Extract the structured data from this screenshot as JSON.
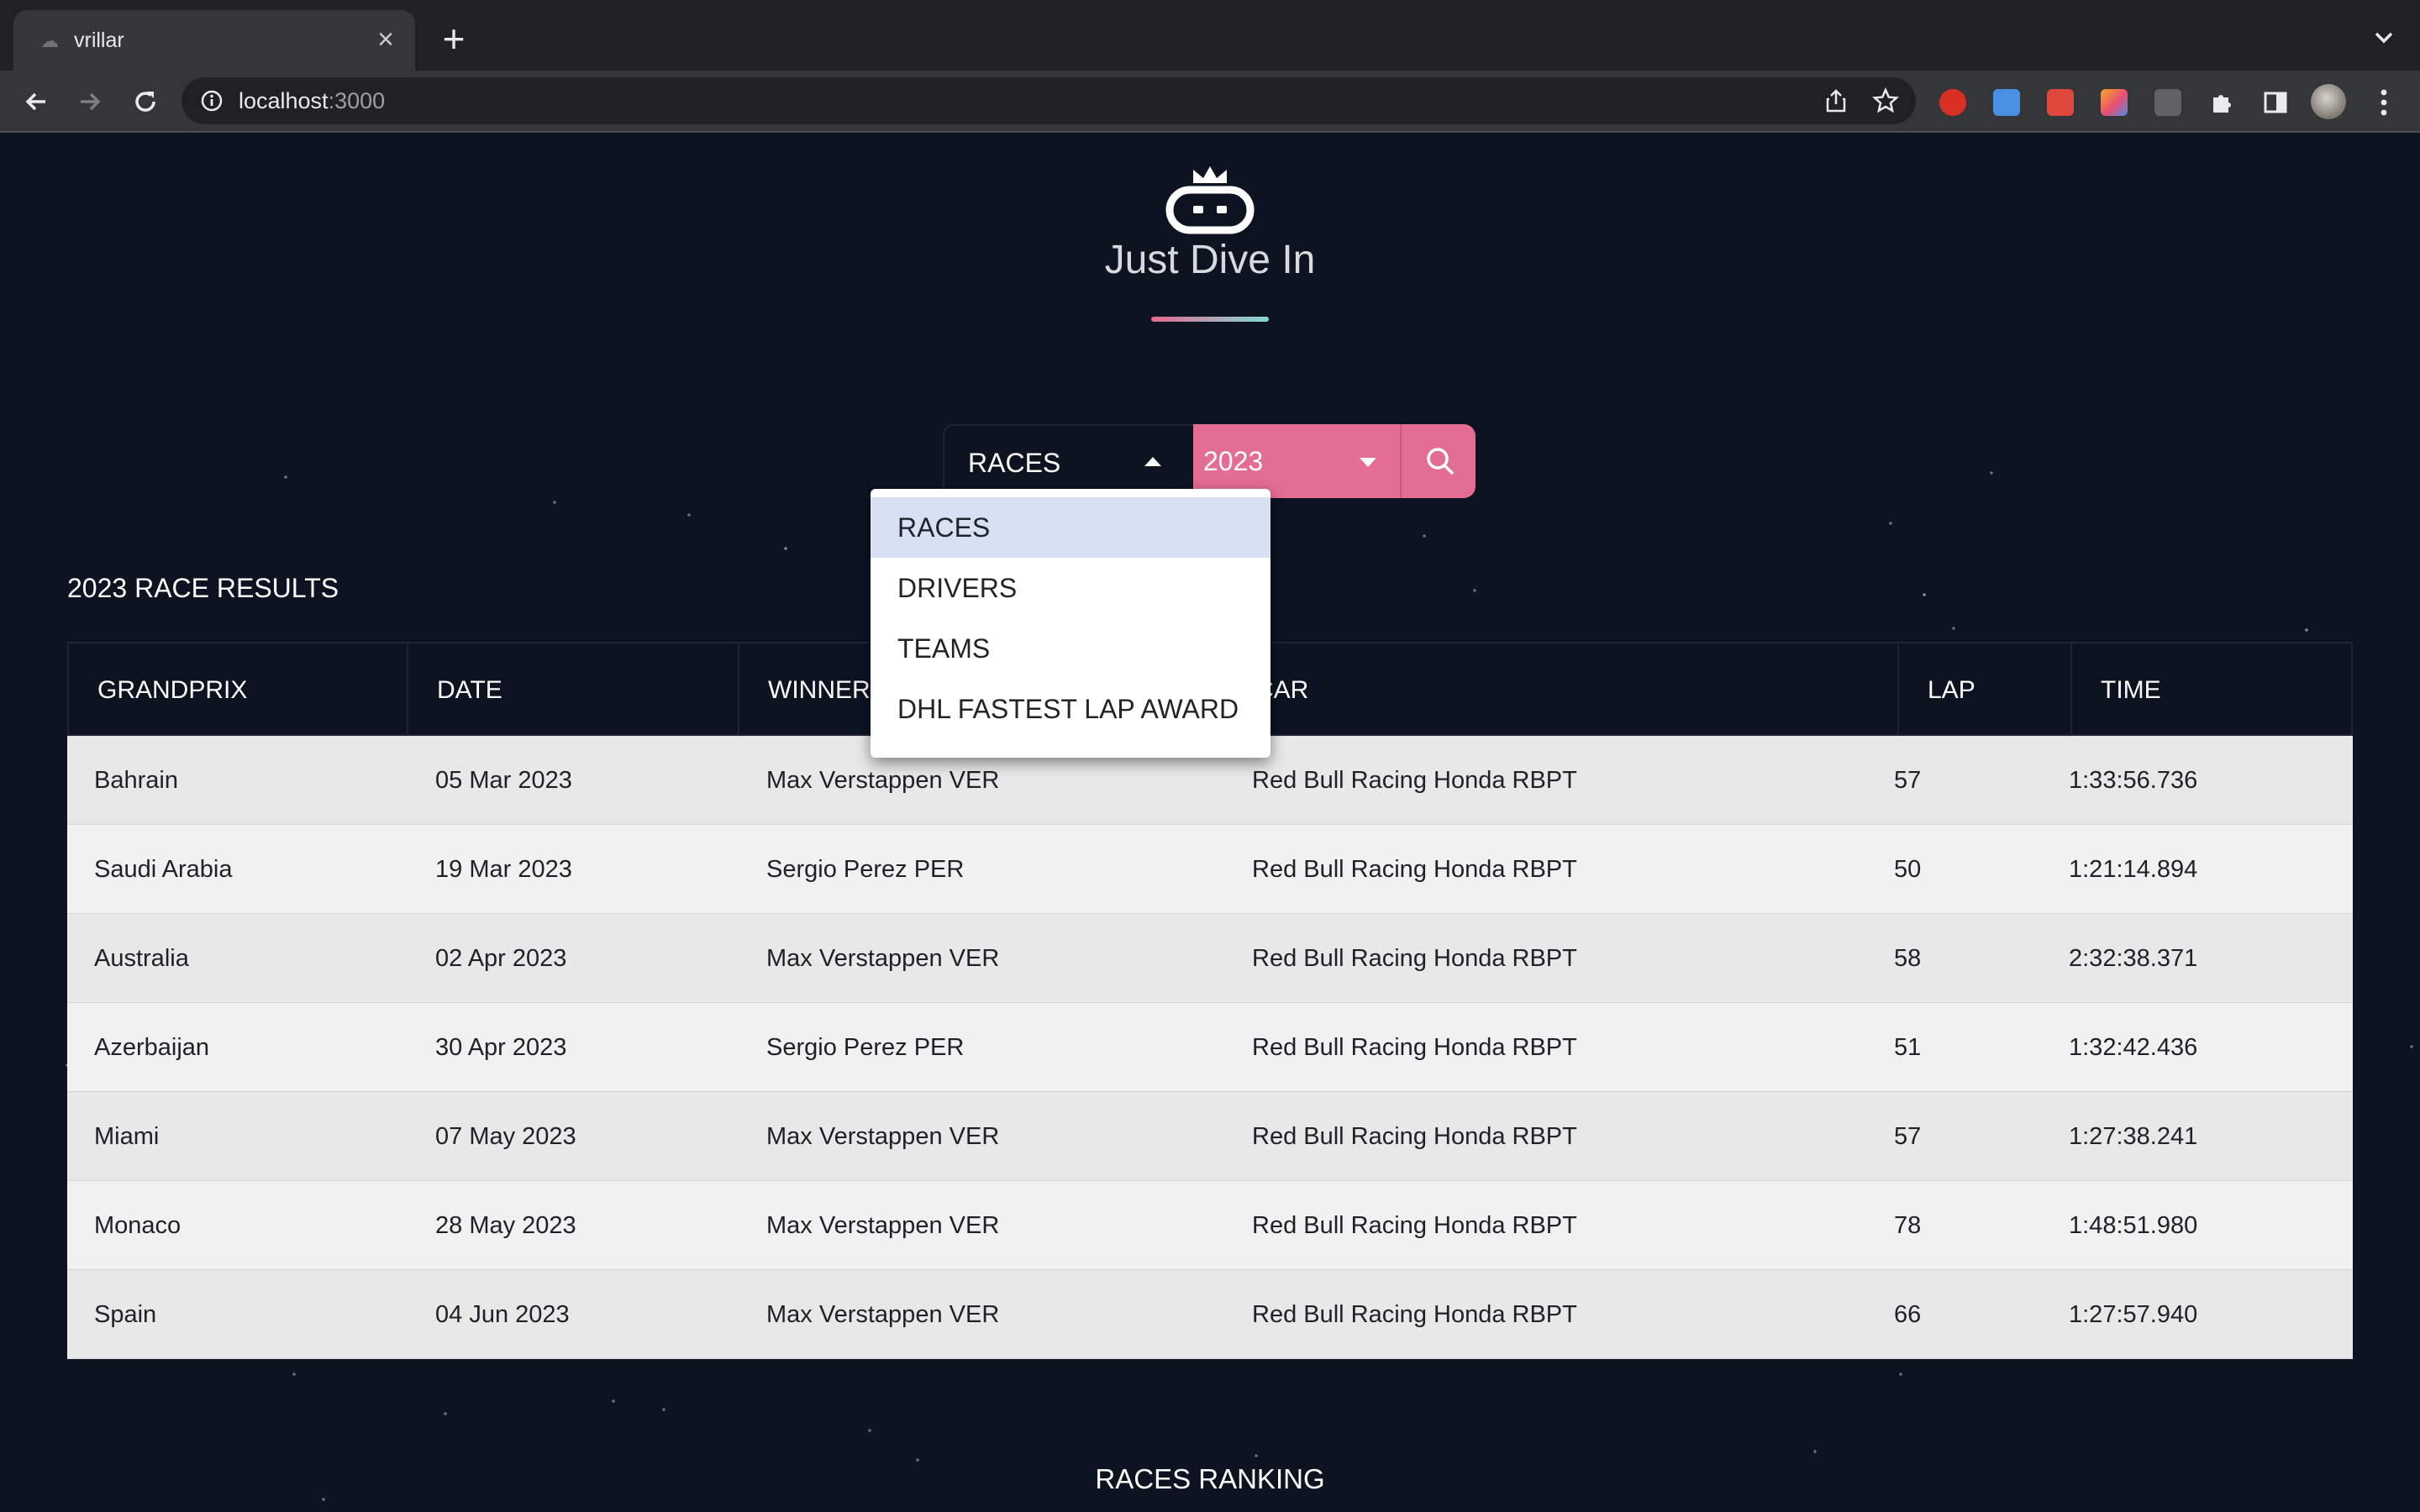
{
  "browser": {
    "tab_title": "vrillar",
    "tab_close": "×",
    "new_tab": "+",
    "url_host": "localhost",
    "url_port": ":3000"
  },
  "page": {
    "brand": "Just Dive In",
    "colors": {
      "accent": "#e46d93",
      "accent_gradient_end": "#83d9d4",
      "background": "#0d1321"
    },
    "search": {
      "type_value": "RACES",
      "year_value": "2023",
      "type_options": [
        "RACES",
        "DRIVERS",
        "TEAMS",
        "DHL FASTEST LAP AWARD"
      ],
      "type_options_open": true,
      "selected_option": "RACES"
    },
    "results_title": "2023 RACE RESULTS",
    "table": {
      "headers": [
        "GRANDPRIX",
        "DATE",
        "WINNER",
        "CAR",
        "LAP",
        "TIME"
      ],
      "rows": [
        [
          "Bahrain",
          "05 Mar 2023",
          "Max Verstappen VER",
          "Red Bull Racing Honda RBPT",
          "57",
          "1:33:56.736"
        ],
        [
          "Saudi Arabia",
          "19 Mar 2023",
          "Sergio Perez PER",
          "Red Bull Racing Honda RBPT",
          "50",
          "1:21:14.894"
        ],
        [
          "Australia",
          "02 Apr 2023",
          "Max Verstappen VER",
          "Red Bull Racing Honda RBPT",
          "58",
          "2:32:38.371"
        ],
        [
          "Azerbaijan",
          "30 Apr 2023",
          "Sergio Perez PER",
          "Red Bull Racing Honda RBPT",
          "51",
          "1:32:42.436"
        ],
        [
          "Miami",
          "07 May 2023",
          "Max Verstappen VER",
          "Red Bull Racing Honda RBPT",
          "57",
          "1:27:38.241"
        ],
        [
          "Monaco",
          "28 May 2023",
          "Max Verstappen VER",
          "Red Bull Racing Honda RBPT",
          "78",
          "1:48:51.980"
        ],
        [
          "Spain",
          "04 Jun 2023",
          "Max Verstappen VER",
          "Red Bull Racing Honda RBPT",
          "66",
          "1:27:57.940"
        ]
      ]
    },
    "ranking_title": "RACES RANKING"
  }
}
